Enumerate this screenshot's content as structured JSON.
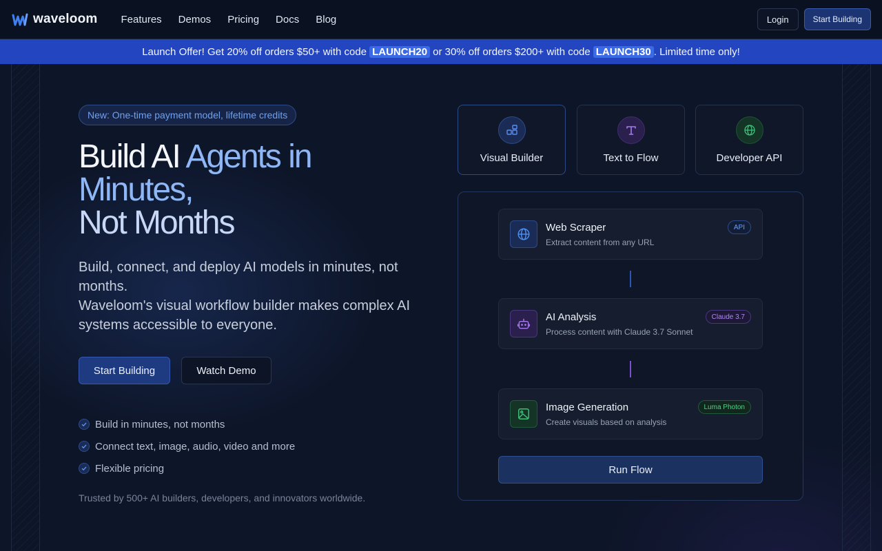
{
  "nav": {
    "brand": "waveloom",
    "links": [
      "Features",
      "Demos",
      "Pricing",
      "Docs",
      "Blog"
    ],
    "login": "Login",
    "start": "Start Building"
  },
  "banner": {
    "part1": "Launch Offer! Get 20% off orders $50+ with code",
    "code1": "LAUNCH20",
    "part2": "or 30% off orders $200+ with code",
    "code2": "LAUNCH30",
    "part3": ". Limited time only!"
  },
  "hero": {
    "pill": "New: One-time payment model, lifetime credits",
    "headline": {
      "a": "Build AI ",
      "b": "Agents in Minutes,",
      "c": "Not Months"
    },
    "sub_line1": "Build, connect, and deploy AI models in minutes, not months.",
    "sub_line2": "Waveloom's visual workflow builder makes complex AI systems accessible to everyone.",
    "cta_primary": "Start Building",
    "cta_secondary": "Watch Demo",
    "features": [
      "Build in minutes, not months",
      "Connect text, image, audio, video and more",
      "Flexible pricing"
    ],
    "trusted": "Trusted by 500+ AI builders, developers, and innovators worldwide."
  },
  "modes": [
    {
      "label": "Visual Builder",
      "icon": "blocks-icon",
      "color": "#5b8def"
    },
    {
      "label": "Text to Flow",
      "icon": "text-icon",
      "color": "#a77bf0"
    },
    {
      "label": "Developer API",
      "icon": "globe-icon",
      "color": "#3fc27a"
    }
  ],
  "flow": {
    "nodes": [
      {
        "title": "Web Scraper",
        "desc": "Extract content from any URL",
        "badge": "API",
        "icon": "globe-icon",
        "color": "#4f8ef0"
      },
      {
        "title": "AI Analysis",
        "desc": "Process content with Claude 3.7 Sonnet",
        "badge": "Claude 3.7",
        "icon": "robot-icon",
        "color": "#a67af0"
      },
      {
        "title": "Image Generation",
        "desc": "Create visuals based on analysis",
        "badge": "Luma Photon",
        "icon": "image-icon",
        "color": "#3fc27a"
      }
    ],
    "run": "Run Flow"
  }
}
